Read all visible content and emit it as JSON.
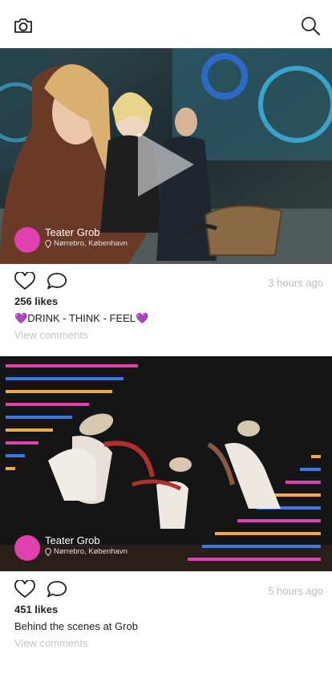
{
  "header": {
    "camera_icon": "camera-icon",
    "search_icon": "search-icon"
  },
  "posts": [
    {
      "author": "Teater Grob",
      "location": "Nørrebro, København",
      "time": "3 hours ago",
      "likes": "256 likes",
      "caption_heart": "💜",
      "caption_text": "DRINK - THINK - FEEL",
      "comments": "View comments",
      "avatar_color": "#e040b0"
    },
    {
      "author": "Teater Grob",
      "location": "Nørrebro, København",
      "time": "5 hours ago",
      "likes": "451 likes",
      "caption": "Behind the scenes at Grob",
      "comments": "View comments",
      "avatar_color": "#e040b0"
    }
  ],
  "colors": {
    "accent_pink": "#e040b0",
    "stripe_blue": "#3c78e6",
    "stripe_orange": "#f0a850",
    "muted_text": "#bdbdbd"
  }
}
